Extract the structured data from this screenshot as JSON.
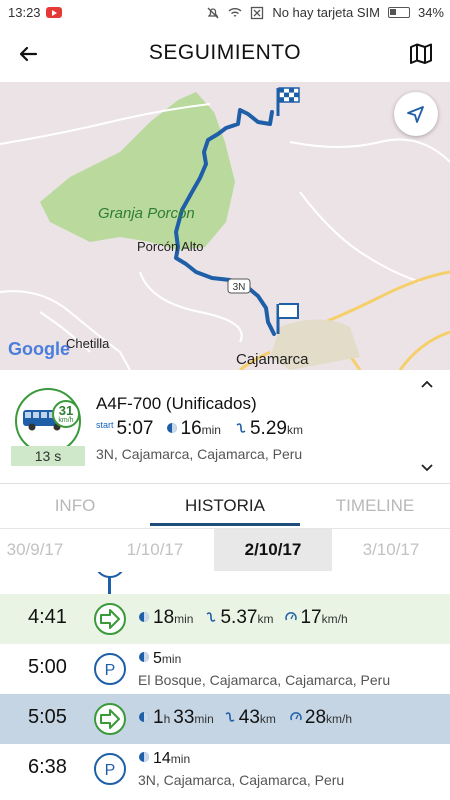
{
  "status_bar": {
    "time": "13:23",
    "network_text": "No hay tarjeta SIM",
    "battery": "34%"
  },
  "header": {
    "title": "SEGUIMIENTO"
  },
  "map": {
    "labels": {
      "granja": "Granja Porcon",
      "porcon_alto": "Porcón Alto",
      "route": "3N",
      "chetilla": "Chetilla",
      "cajamarca": "Cajamarca",
      "google": "Google"
    }
  },
  "vehicle": {
    "name": "A4F-700 (Unificados)",
    "speed": "31",
    "speed_unit": "km/h",
    "time_badge": "13 s",
    "start_label": "start",
    "start_time": "5:07",
    "duration_value": "16",
    "duration_unit": "min",
    "distance_value": "5.29",
    "distance_unit": "km",
    "address": "3N, Cajamarca, Cajamarca, Peru"
  },
  "tabs": [
    "INFO",
    "HISTORIA",
    "TIMELINE"
  ],
  "active_tab": "HISTORIA",
  "dates": [
    "30/9/17",
    "1/10/17",
    "2/10/17",
    "3/10/17"
  ],
  "active_date": "2/10/17",
  "timeline": [
    {
      "time": "4:41",
      "type": "drive",
      "duration": "18",
      "duration_unit": "min",
      "distance": "5.37",
      "distance_unit": "km",
      "speed": "17",
      "speed_unit": "km/h"
    },
    {
      "time": "5:00",
      "type": "parking",
      "duration": "5",
      "duration_unit": "min",
      "address": "El Bosque, Cajamarca, Cajamarca, Peru"
    },
    {
      "time": "5:05",
      "type": "drive",
      "duration_h": "1",
      "duration_h_unit": "h",
      "duration": "33",
      "duration_unit": "min",
      "distance": "43",
      "distance_unit": "km",
      "speed": "28",
      "speed_unit": "km/h"
    },
    {
      "time": "6:38",
      "type": "parking",
      "duration": "14",
      "duration_unit": "min",
      "address": "3N, Cajamarca, Cajamarca, Peru"
    }
  ],
  "colors": {
    "route": "#1f5fa8",
    "accent_green": "#3a9a3a",
    "highlight_green": "#eaf4e4",
    "highlight_blue": "#c5d5e4",
    "tab_underline": "#1f4e7a"
  }
}
